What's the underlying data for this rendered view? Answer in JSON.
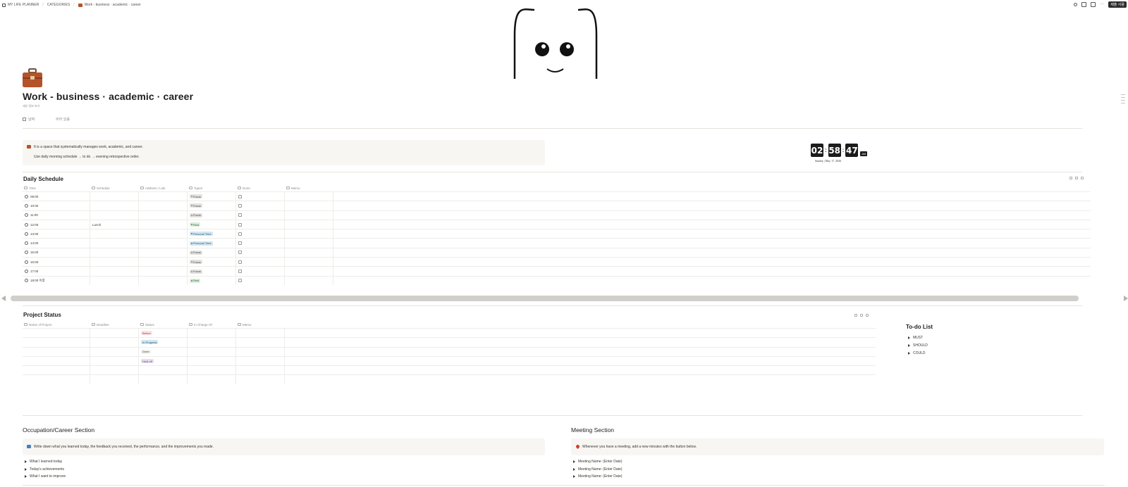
{
  "breadcrumb": {
    "items": [
      "MY LIFE PLANNER",
      "CATEGORIES",
      "Work - business · academic · career"
    ]
  },
  "topbar": {
    "more_label": "···",
    "button_label": "제출 사용"
  },
  "page": {
    "title": "Work - business · academic · career",
    "subtitle": "세부 정보 보기",
    "properties": [
      {
        "label": "날짜",
        "value": "비어 있음"
      }
    ]
  },
  "intro_callout": {
    "line1": "It is a space that systematically manages work, academic, and career.",
    "line2": "Use daily morning schedule → to do → evening retrospective order."
  },
  "clock": {
    "hours": "02",
    "minutes": "58",
    "seconds": "47",
    "ampm": "AM",
    "date": "Sunday | May 17, 2026"
  },
  "daily_schedule": {
    "title": "Daily Schedule",
    "columns": [
      "Time",
      "Schedule",
      "Address / Link",
      "Types",
      "Done",
      "Memo"
    ],
    "rows": [
      {
        "time": "09:00",
        "schedule": "",
        "type": "Focus",
        "type_style": "focus"
      },
      {
        "time": "10:00",
        "schedule": "",
        "type": "Focus",
        "type_style": "focus"
      },
      {
        "time": "11:00",
        "schedule": "",
        "type": "Focus",
        "type_style": "focus"
      },
      {
        "time": "12:00",
        "schedule": "Lunch",
        "type": "Rest",
        "type_style": "rest"
      },
      {
        "time": "13:00",
        "schedule": "",
        "type": "Personal Time",
        "type_style": "pt"
      },
      {
        "time": "14:00",
        "schedule": "",
        "type": "Personal Time",
        "type_style": "pt"
      },
      {
        "time": "15:00",
        "schedule": "",
        "type": "Focus",
        "type_style": "focus"
      },
      {
        "time": "16:00",
        "schedule": "",
        "type": "Focus",
        "type_style": "focus"
      },
      {
        "time": "17:00",
        "schedule": "",
        "type": "Focus",
        "type_style": "focus"
      },
      {
        "time": "18:00 이후",
        "schedule": "",
        "type": "Rest",
        "type_style": "rest"
      }
    ]
  },
  "project_status": {
    "title": "Project Status",
    "columns": [
      "Name of Project",
      "Deadline",
      "Status",
      "In Charge Of",
      "Memo"
    ],
    "rows": [
      {
        "status": "Before",
        "status_style": "before"
      },
      {
        "status": "In Progress",
        "status_style": "progress"
      },
      {
        "status": "Done",
        "status_style": "done"
      },
      {
        "status": "Hold off",
        "status_style": "hold"
      },
      {
        "status": "",
        "status_style": ""
      },
      {
        "status": "",
        "status_style": ""
      }
    ]
  },
  "todo": {
    "title": "To-do List",
    "items": [
      "MUST",
      "SHOULD",
      "COULD"
    ]
  },
  "career_section": {
    "title": "Occupation/Career Section",
    "callout": "Write down what you learned today, the feedback you received, the performance, and the improvements you made.",
    "items": [
      "What I learned today",
      "Today's achievements",
      "What I want to improve"
    ]
  },
  "meeting_section": {
    "title": "Meeting Section",
    "callout": "Whenever you have a meeting, add a new minutes with the button below.",
    "items": [
      "Meeting Name: (Enter Date)",
      "Meeting Name: (Enter Date)",
      "Meeting Name: (Enter Date)"
    ]
  }
}
